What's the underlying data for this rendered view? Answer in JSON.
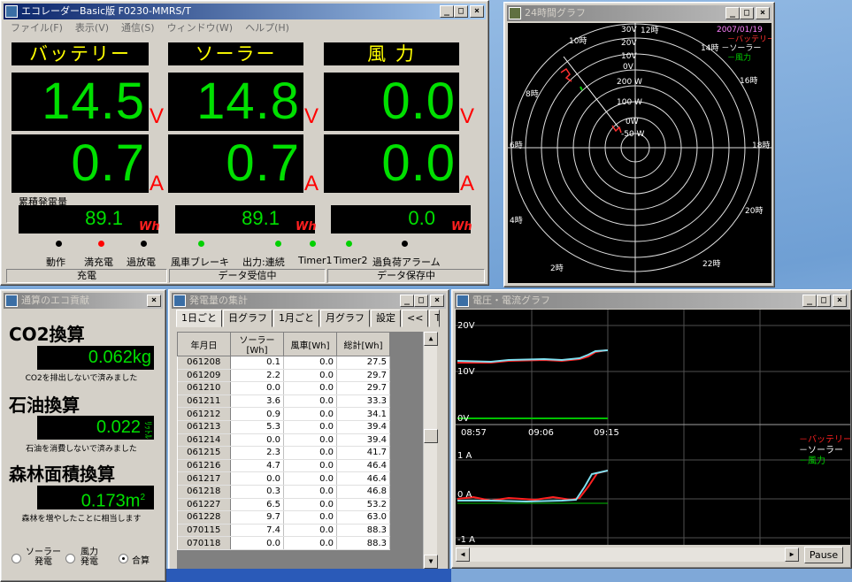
{
  "main_window": {
    "title": "エコレーダーBasic版  F0230-MMRS/T",
    "menu": [
      "ファイル(F)",
      "表示(V)",
      "通信(S)",
      "ウィンドウ(W)",
      "ヘルプ(H)"
    ],
    "battery": {
      "label": "バッテリー",
      "voltage": "14.5",
      "current": "0.7"
    },
    "solar": {
      "label": "ソーラー",
      "voltage": "14.8",
      "current": "0.7"
    },
    "wind": {
      "label": "風  力",
      "voltage": "0.0",
      "current": "0.0"
    },
    "unit_v": "V",
    "unit_a": "A",
    "cumulative_label": "累積発電量",
    "cumulative_battery": "89.1",
    "cumulative_solar": "89.1",
    "cumulative_wind": "0.0",
    "unit_wh": "Wh",
    "indicators": [
      {
        "label": "動作",
        "color": "#000000"
      },
      {
        "label": "満充電",
        "color": "#ff0000"
      },
      {
        "label": "過放電",
        "color": "#000000"
      },
      {
        "label": "風車ブレーキ",
        "color": "#00d000"
      },
      {
        "label": "出力:連続",
        "color": "#00d000"
      },
      {
        "label": "Timer1",
        "color": "#00d000"
      },
      {
        "label": "Timer2",
        "color": "#00d000"
      },
      {
        "label": "過負荷アラーム",
        "color": "#000000"
      }
    ],
    "status": [
      "充電",
      "データ受信中",
      "データ保存中"
    ]
  },
  "polar_window": {
    "title": "24時間グラフ",
    "date": "2007/01/19",
    "legend": [
      "－バッテリー",
      "14時 －ソーラー",
      "－風力"
    ],
    "hours": [
      "12時",
      "14時",
      "16時",
      "18時",
      "20時",
      "22時",
      "2時",
      "4時",
      "6時",
      "8時",
      "10時"
    ],
    "ring_labels": [
      "30V",
      "20V",
      "10V",
      "0V",
      "200 W",
      "100 W",
      "0W",
      "-50 W"
    ]
  },
  "eco_window": {
    "title": "通算のエコ貢献",
    "co2": {
      "title": "CO2換算",
      "value": "0.062kg",
      "note": "CO2を排出しないで済みました"
    },
    "oil": {
      "title": "石油換算",
      "value": "0.022",
      "unit": "ﾘｯﾄﾙ",
      "note": "石油を消費しないで済みました"
    },
    "forest": {
      "title": "森林面積換算",
      "value": "0.173m",
      "sup": "2",
      "note": "森林を増やしたことに相当します"
    },
    "radios": [
      {
        "label1": "ソーラー",
        "label2": "発電",
        "checked": false
      },
      {
        "label1": "風力",
        "label2": "発電",
        "checked": false
      },
      {
        "label1": "合算",
        "label2": "",
        "checked": true
      }
    ]
  },
  "summary_window": {
    "title": "発電量の集計",
    "tabs": [
      "1日ごと",
      "日グラフ",
      "1月ごと",
      "月グラフ",
      "設定",
      "<<",
      "T"
    ],
    "columns": [
      "年月日",
      "ソーラー[Wh]",
      "風車[Wh]",
      "総計[Wh]"
    ],
    "rows": [
      [
        "061208",
        "0.1",
        "0.0",
        "27.5"
      ],
      [
        "061209",
        "2.2",
        "0.0",
        "29.7"
      ],
      [
        "061210",
        "0.0",
        "0.0",
        "29.7"
      ],
      [
        "061211",
        "3.6",
        "0.0",
        "33.3"
      ],
      [
        "061212",
        "0.9",
        "0.0",
        "34.1"
      ],
      [
        "061213",
        "5.3",
        "0.0",
        "39.4"
      ],
      [
        "061214",
        "0.0",
        "0.0",
        "39.4"
      ],
      [
        "061215",
        "2.3",
        "0.0",
        "41.7"
      ],
      [
        "061216",
        "4.7",
        "0.0",
        "46.4"
      ],
      [
        "061217",
        "0.0",
        "0.0",
        "46.4"
      ],
      [
        "061218",
        "0.3",
        "0.0",
        "46.8"
      ],
      [
        "061227",
        "6.5",
        "0.0",
        "53.2"
      ],
      [
        "061228",
        "9.7",
        "0.0",
        "63.0"
      ],
      [
        "070115",
        "7.4",
        "0.0",
        "88.3"
      ],
      [
        "070118",
        "0.0",
        "0.0",
        "88.3"
      ]
    ]
  },
  "vi_window": {
    "title": "電圧・電流グラフ",
    "y_labels_top": [
      "20V",
      "10V",
      "0V"
    ],
    "x_labels": [
      "08:57",
      "09:06",
      "09:15"
    ],
    "y_labels_bottom": [
      "1 A",
      "0 A",
      "-1 A"
    ],
    "legend": [
      "－バッテリー",
      "－ソーラー",
      "－風力"
    ],
    "pause_label": "Pause"
  },
  "colors": {
    "battery": "#ff0000",
    "solar": "#ffffff",
    "wind": "#00d000",
    "value": "#00e000",
    "header": "#ffff00"
  }
}
